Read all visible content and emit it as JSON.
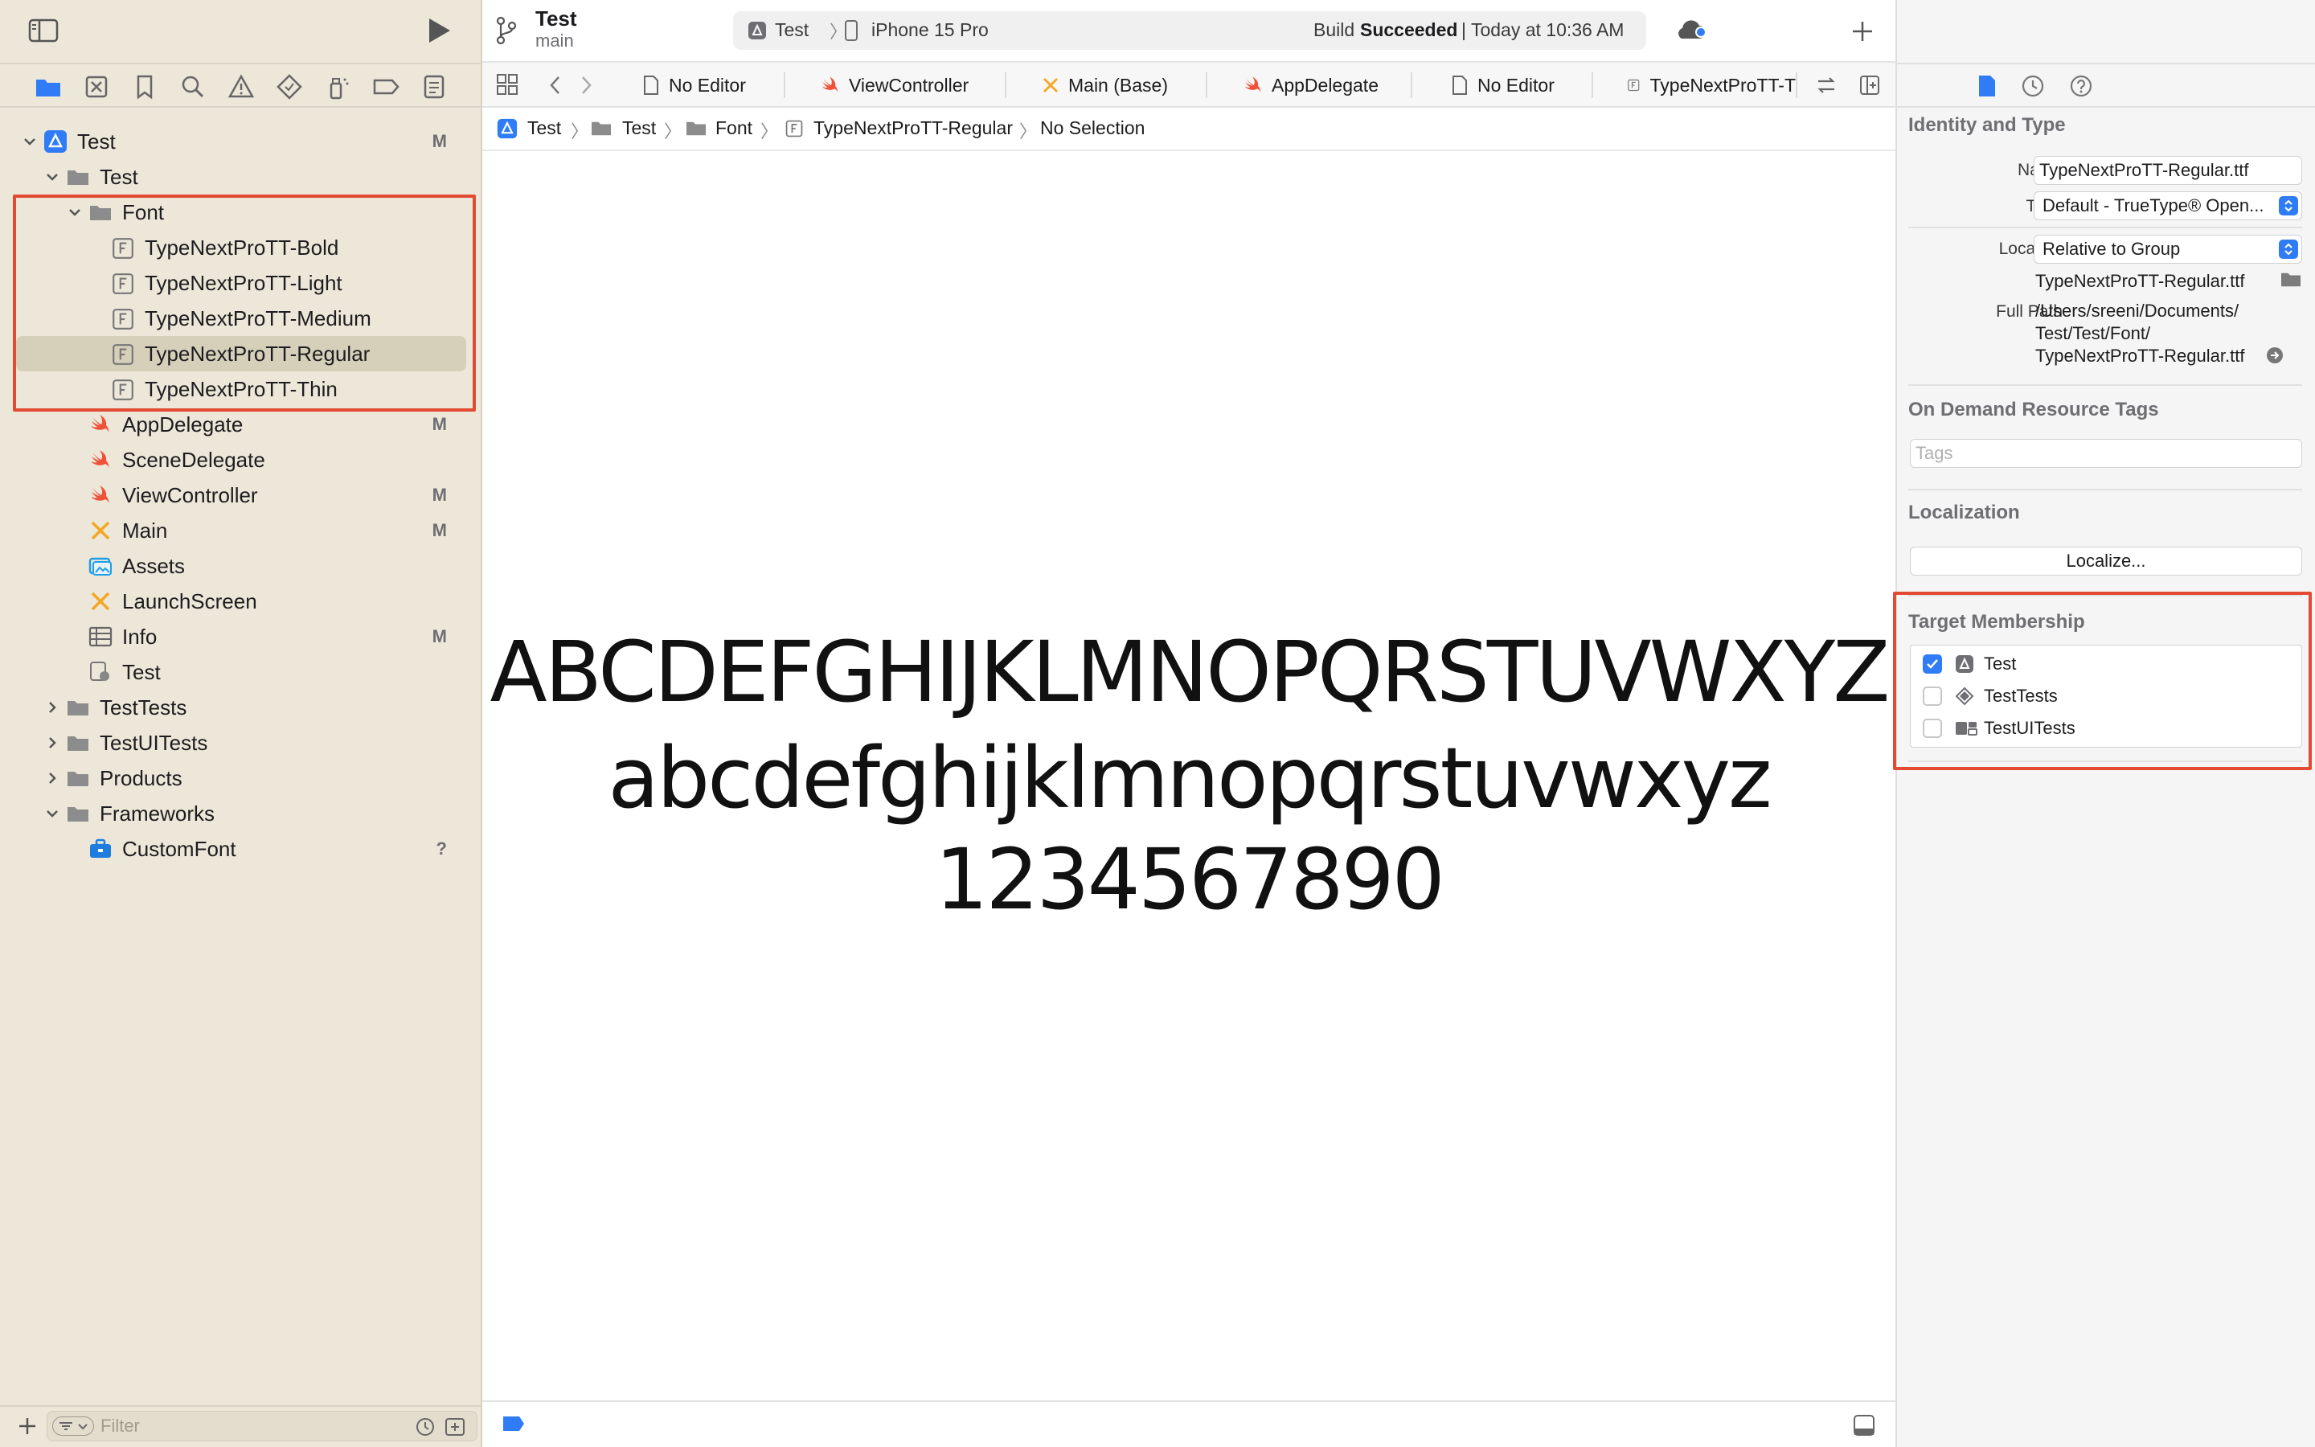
{
  "toolbar": {
    "project_name": "Test",
    "branch": "main",
    "scheme": "Test",
    "device": "iPhone 15 Pro",
    "build_prefix": "Build",
    "build_status": "Succeeded",
    "build_time": "| Today at 10:36 AM"
  },
  "tabs": [
    {
      "label": "No Editor",
      "icon": "document-icon"
    },
    {
      "label": "ViewController",
      "icon": "swift-icon"
    },
    {
      "label": "Main (Base)",
      "icon": "storyboard-icon"
    },
    {
      "label": "AppDelegate",
      "icon": "swift-icon"
    },
    {
      "label": "No Editor",
      "icon": "document-icon"
    },
    {
      "label": "TypeNextProTT-T",
      "icon": "font-file-icon"
    }
  ],
  "jumpbar": {
    "items": [
      "Test",
      "Test",
      "Font",
      "TypeNextProTT-Regular",
      "No Selection"
    ]
  },
  "navigator": {
    "items": [
      {
        "label": "Test",
        "badge": "M",
        "icon": "project-icon"
      },
      {
        "label": "Test",
        "badge": "",
        "icon": "folder-icon"
      },
      {
        "label": "Font",
        "badge": "",
        "icon": "folder-icon"
      },
      {
        "label": "TypeNextProTT-Bold",
        "badge": "",
        "icon": "font-file-icon"
      },
      {
        "label": "TypeNextProTT-Light",
        "badge": "",
        "icon": "font-file-icon"
      },
      {
        "label": "TypeNextProTT-Medium",
        "badge": "",
        "icon": "font-file-icon"
      },
      {
        "label": "TypeNextProTT-Regular",
        "badge": "",
        "icon": "font-file-icon"
      },
      {
        "label": "TypeNextProTT-Thin",
        "badge": "",
        "icon": "font-file-icon"
      },
      {
        "label": "AppDelegate",
        "badge": "M",
        "icon": "swift-icon"
      },
      {
        "label": "SceneDelegate",
        "badge": "",
        "icon": "swift-icon"
      },
      {
        "label": "ViewController",
        "badge": "M",
        "icon": "swift-icon"
      },
      {
        "label": "Main",
        "badge": "M",
        "icon": "storyboard-icon"
      },
      {
        "label": "Assets",
        "badge": "",
        "icon": "assets-icon"
      },
      {
        "label": "LaunchScreen",
        "badge": "",
        "icon": "storyboard-icon"
      },
      {
        "label": "Info",
        "badge": "M",
        "icon": "plist-icon"
      },
      {
        "label": "Test",
        "badge": "",
        "icon": "entitlements-icon"
      },
      {
        "label": "TestTests",
        "badge": "",
        "icon": "folder-icon"
      },
      {
        "label": "TestUITests",
        "badge": "",
        "icon": "folder-icon"
      },
      {
        "label": "Products",
        "badge": "",
        "icon": "folder-icon"
      },
      {
        "label": "Frameworks",
        "badge": "",
        "icon": "folder-icon"
      },
      {
        "label": "CustomFont",
        "badge": "?",
        "icon": "framework-icon"
      }
    ],
    "filter_placeholder": "Filter"
  },
  "preview": {
    "uppercase": "ABCDEFGHIJKLMNOPQRSTUVWXYZ",
    "lowercase": "abcdefghijklmnopqrstuvwxyz",
    "digits": "1234567890"
  },
  "inspector": {
    "identity_title": "Identity and Type",
    "name_label": "Name",
    "name_value": "TypeNextProTT-Regular.ttf",
    "type_label": "Type",
    "type_value": "Default - TrueType® Open...",
    "location_label": "Location",
    "location_value": "Relative to Group",
    "location_file": "TypeNextProTT-Regular.ttf",
    "fullpath_label": "Full Path",
    "fullpath_line1": "/Users/sreeni/Documents/",
    "fullpath_line2": "Test/Test/Font/",
    "fullpath_line3": "TypeNextProTT-Regular.ttf",
    "odr_title": "On Demand Resource Tags",
    "tags_placeholder": "Tags",
    "localization_title": "Localization",
    "localize_button": "Localize...",
    "target_title": "Target Membership",
    "targets": [
      {
        "name": "Test",
        "checked": true
      },
      {
        "name": "TestTests",
        "checked": false
      },
      {
        "name": "TestUITests",
        "checked": false
      }
    ]
  },
  "colors": {
    "accent": "#2f7cf6",
    "highlight_box": "#e24a33",
    "swift": "#f05138",
    "storyboard": "#f5a623",
    "sidebar_bg": "#ece7d8"
  }
}
